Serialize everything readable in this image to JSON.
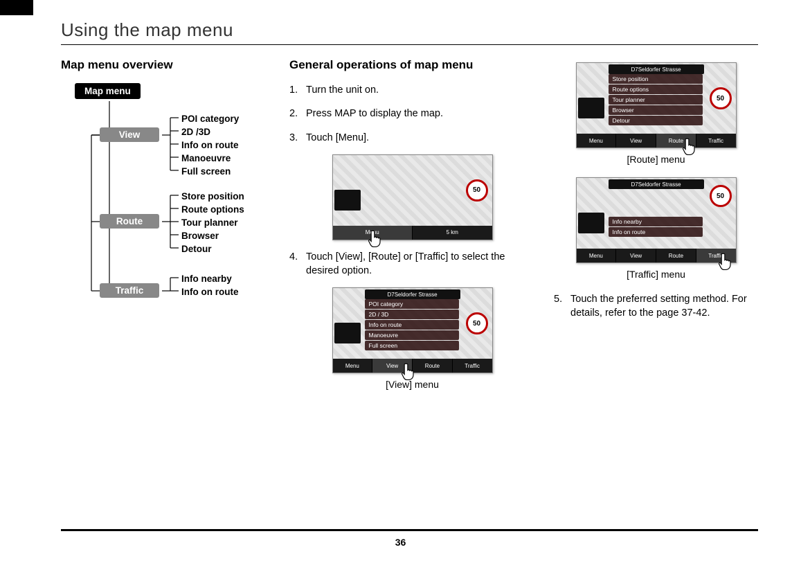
{
  "page": {
    "title": "Using the map menu",
    "number": "36"
  },
  "col1": {
    "heading": "Map menu overview",
    "root": "Map menu",
    "groups": [
      {
        "label": "View",
        "items": [
          "POI category",
          "2D /3D",
          "Info on route",
          "Manoeuvre",
          "Full screen"
        ]
      },
      {
        "label": "Route",
        "items": [
          "Store position",
          "Route options",
          "Tour planner",
          "Browser",
          "Detour"
        ]
      },
      {
        "label": "Traffic",
        "items": [
          "Info nearby",
          "Info on route"
        ]
      }
    ]
  },
  "col2": {
    "heading": "General operations of map menu",
    "steps": [
      "Turn the unit on.",
      "Press MAP to display the map.",
      "Touch [Menu].",
      "Touch [View], [Route] or [Traffic] to select the desired option."
    ],
    "tabs": [
      "Menu",
      "View",
      "Route",
      "Traffic"
    ],
    "top_label": "D7Seldorfer Strasse",
    "speed": "50",
    "shot_view_panel": [
      "POI category",
      "2D / 3D",
      "Info on route",
      "Manoeuvre",
      "Full screen"
    ],
    "caption_view": "[View] menu"
  },
  "col3": {
    "shot_route_panel": [
      "Store position",
      "Route options",
      "Tour planner",
      "Browser",
      "Detour"
    ],
    "caption_route": "[Route] menu",
    "shot_traffic_panel": [
      "Info nearby",
      "Info on route"
    ],
    "caption_traffic": "[Traffic] menu",
    "step5": "Touch the preferred setting method. For details, refer to the page 37-42."
  }
}
